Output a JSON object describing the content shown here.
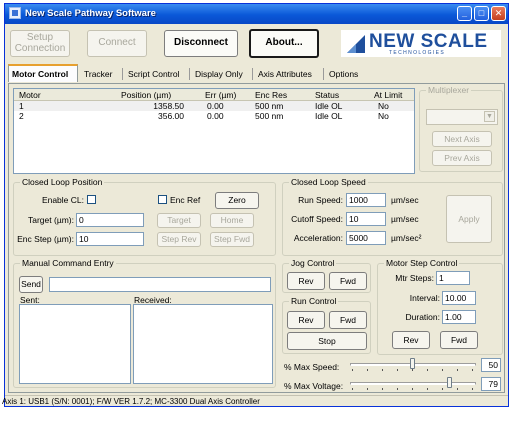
{
  "window": {
    "title": "New Scale Pathway Software"
  },
  "toolbar": {
    "setup_label": "Setup\nConnection",
    "connect_label": "Connect",
    "disconnect_label": "Disconnect",
    "about_label": "About...",
    "logo_main": "NEW SCALE",
    "logo_sub": "T E C H N O L O G I E S"
  },
  "tabs": [
    "Motor Control",
    "Tracker",
    "Script Control",
    "Display Only",
    "Axis Attributes",
    "Options"
  ],
  "motor_table": {
    "headers": [
      "Motor",
      "Position (µm)",
      "Err (µm)",
      "Enc Res",
      "Status",
      "At Limit"
    ],
    "rows": [
      [
        "1",
        "1358.50",
        "0.00",
        "500 nm",
        "Idle OL",
        "No"
      ],
      [
        "2",
        "356.00",
        "0.00",
        "500 nm",
        "Idle OL",
        "No"
      ]
    ]
  },
  "multiplexer": {
    "title": "Multiplexer",
    "next_label": "Next Axis",
    "prev_label": "Prev Axis"
  },
  "closed_loop_position": {
    "title": "Closed Loop Position",
    "enable_label": "Enable CL:",
    "enc_ref_label": "Enc Ref",
    "zero_label": "Zero",
    "target_label": "Target (µm):",
    "target_value": "0",
    "target_btn": "Target",
    "home_btn": "Home",
    "enc_step_label": "Enc Step (µm):",
    "enc_step_value": "10",
    "step_rev_btn": "Step Rev",
    "step_fwd_btn": "Step Fwd"
  },
  "closed_loop_speed": {
    "title": "Closed Loop Speed",
    "run_speed_label": "Run Speed:",
    "run_speed_value": "1000",
    "run_speed_unit": "µm/sec",
    "cutoff_label": "Cutoff Speed:",
    "cutoff_value": "10",
    "cutoff_unit": "µm/sec",
    "accel_label": "Acceleration:",
    "accel_value": "5000",
    "accel_unit": "µm/sec²",
    "apply_label": "Apply"
  },
  "manual_command": {
    "title": "Manual Command Entry",
    "send_label": "Send",
    "sent_label": "Sent:",
    "received_label": "Received:"
  },
  "jog_control": {
    "title": "Jog Control",
    "rev_label": "Rev",
    "fwd_label": "Fwd"
  },
  "run_control": {
    "title": "Run Control",
    "rev_label": "Rev",
    "fwd_label": "Fwd",
    "stop_label": "Stop"
  },
  "motor_step": {
    "title": "Motor Step Control",
    "steps_label": "Mtr Steps:",
    "steps_value": "1",
    "interval_label": "Interval:",
    "interval_value": "10.00",
    "duration_label": "Duration:",
    "duration_value": "1.00",
    "rev_label": "Rev",
    "fwd_label": "Fwd"
  },
  "sliders": {
    "max_speed_label": "% Max Speed:",
    "max_speed_value": "50",
    "max_voltage_label": "% Max Voltage:",
    "max_voltage_value": "79"
  },
  "status_bar": {
    "text": "Axis 1: USB1 (S/N: 0001); F/W VER 1.7.2; MC-3300 Dual Axis Controller"
  }
}
